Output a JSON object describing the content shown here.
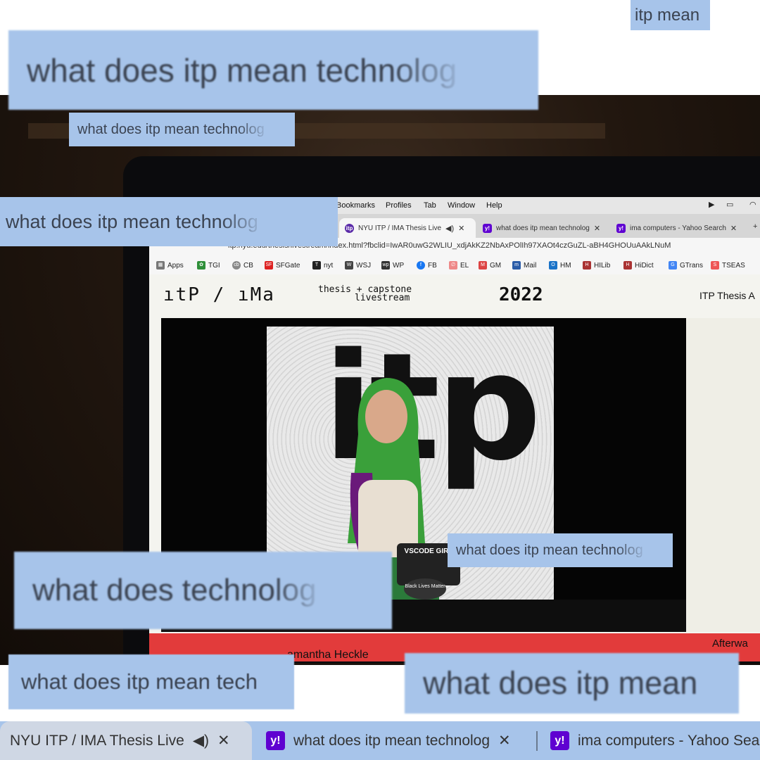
{
  "menubar": {
    "items": [
      "Bookmarks",
      "Profiles",
      "Tab",
      "Window",
      "Help"
    ]
  },
  "tabs": [
    {
      "title": "NYU ITP / IMA Thesis Live",
      "icon": "itp-favicon"
    },
    {
      "title": "what does itp mean technolog",
      "icon": "yahoo-favicon"
    },
    {
      "title": "ima computers - Yahoo Search",
      "icon": "yahoo-favicon"
    }
  ],
  "url": "itp.nyu.edu/thesis/livestream/index.html?fbclid=IwAR0uwG2WLIU_xdjAkKZ2NbAxPOlIh97XAOt4czGuZL-aBH4GHOUuAAkLNuM",
  "bookmarks": [
    "Apps",
    "TGI",
    "CB",
    "SFGate",
    "nyt",
    "WSJ",
    "WP",
    "FB",
    "EL",
    "GM",
    "Mail",
    "HM",
    "HILib",
    "HiDict",
    "GTrans",
    "TSEAS"
  ],
  "page": {
    "logo": "ıtP / ıMa",
    "sub_line1": "thesis + capstone",
    "sub_line2": "livestream",
    "year": "2022",
    "side_title": "ITP Thesis A",
    "presenter": "amantha Heckle",
    "after": "Afterwa",
    "backdrop_text": "itp"
  },
  "stickers": [
    "VSCODE GIRL",
    "Black Lives Matter"
  ],
  "search_strips": [
    "itp mean",
    "what does itp mean technolog",
    "what does itp mean technolog",
    "what does itp mean technolog",
    "what does itp mean technolog",
    "what does technolog",
    "what does itp mean tech",
    "what does itp mean"
  ],
  "bottom_tabs": [
    {
      "title": "NYU ITP / IMA Thesis Live",
      "icon": "itp-favicon"
    },
    {
      "title": "what does itp mean technolog",
      "icon": "yahoo-favicon"
    },
    {
      "title": "ima computers - Yahoo Sea",
      "icon": "yahoo-favicon"
    }
  ],
  "colors": {
    "strip": "#a7c4ea",
    "strip_text": "#3a4250",
    "yahoo": "#5f01d1",
    "caption_bar": "#e23b3b"
  }
}
